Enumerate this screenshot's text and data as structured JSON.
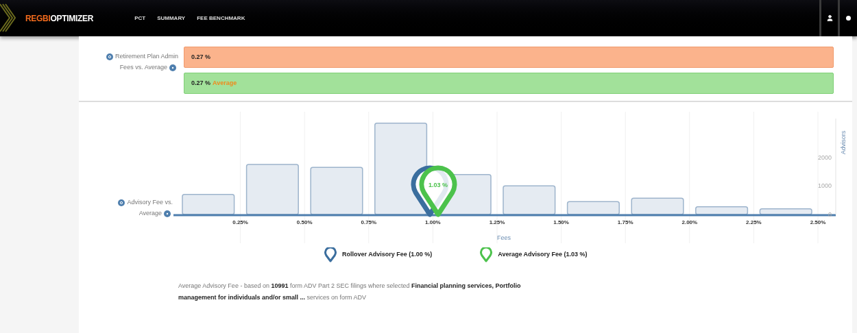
{
  "header": {
    "logo": {
      "part_1": "REGBI",
      "part_2": "OPTIMIZER"
    },
    "nav": [
      {
        "label": "PCT"
      },
      {
        "label": "SUMMARY"
      },
      {
        "label": "FEE BENCHMARK"
      }
    ]
  },
  "admin_fees": {
    "label": "Retirement Plan Admin Fees vs. Average",
    "rows": [
      {
        "kind": "current",
        "value": "0.27 %"
      },
      {
        "kind": "average",
        "value": "0.27 %",
        "tag": "Average"
      }
    ]
  },
  "advisory_fee": {
    "label": "Advisory Fee vs. Average",
    "chart_data": {
      "type": "bar",
      "xlabel": "Fees",
      "ylabel": "Advisors",
      "x": [
        0.125,
        0.375,
        0.625,
        0.875,
        1.125,
        1.375,
        1.625,
        1.875,
        2.125,
        2.375
      ],
      "xlim": [
        0,
        2.5
      ],
      "ylim": [
        0,
        3600
      ],
      "grid": true,
      "values": [
        700,
        1750,
        1650,
        3200,
        1400,
        1000,
        450,
        570,
        270,
        200
      ],
      "xticks": [
        {
          "value": 0.25,
          "label": "0.25%"
        },
        {
          "value": 0.5,
          "label": "0.50%"
        },
        {
          "value": 0.75,
          "label": "0.75%"
        },
        {
          "value": 1.0,
          "label": "1.00%"
        },
        {
          "value": 1.25,
          "label": "1.25%"
        },
        {
          "value": 1.5,
          "label": "1.50%"
        },
        {
          "value": 1.75,
          "label": "1.75%"
        },
        {
          "value": 2.0,
          "label": "2.00%"
        },
        {
          "value": 2.25,
          "label": "2.25%"
        },
        {
          "value": 2.5,
          "label": "2.50%"
        }
      ],
      "yticks": [
        0,
        1000,
        2000
      ]
    },
    "pins": [
      {
        "color": "#3b6e9e"
      },
      {
        "label": "1.03 %",
        "color": "#4cc24c"
      }
    ],
    "legend": [
      {
        "label": "Rollover Advisory Fee (1.00 %)",
        "color": "#3b6e9e"
      },
      {
        "label": "Average Advisory Fee (1.03 %)",
        "color": "#4cc24c"
      }
    ],
    "note": "Average Advisory Fee - based on **10991** form ADV Part 2 SEC filings where selected **Financial planning services, Portfolio management for individuals and/or small ...** services on form ADV"
  }
}
